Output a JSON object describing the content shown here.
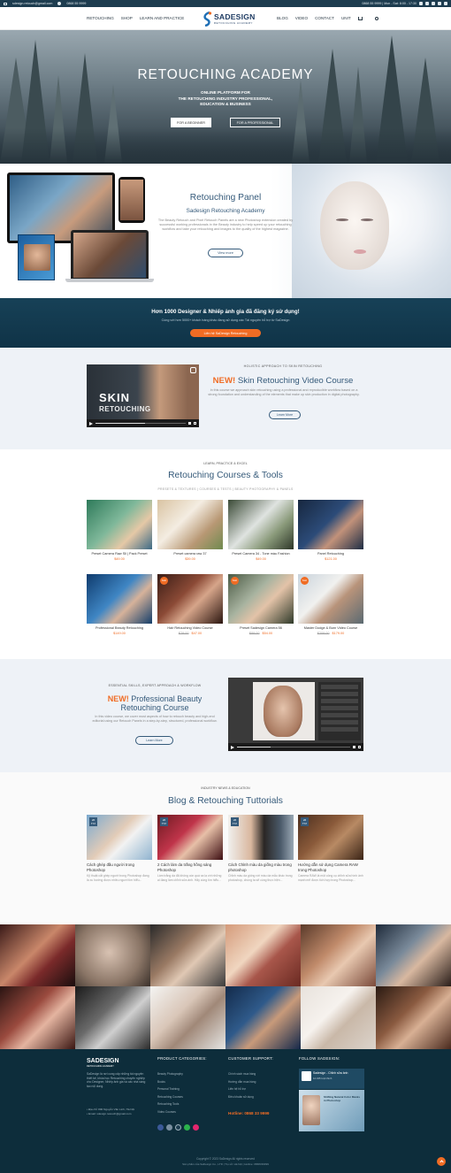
{
  "topbar": {
    "email": "sdesign.retouch@gmail.com",
    "phone": "0868 55 9999",
    "right_text": "0868 55 9999 | Mon - Sat: 8:00 - 17:30"
  },
  "nav": {
    "left": [
      "RETOUCHING",
      "SHOP",
      "LEARN AND PRACTICE"
    ],
    "logo_text": "SADESIGN",
    "logo_sub": "RETOUCHING ACADEMY",
    "right": [
      "BLOG",
      "VIDEO",
      "CONTACT",
      "UNIT"
    ]
  },
  "hero": {
    "title": "RETOUCHING ACADEMY",
    "subtitle_lines": [
      "ONLINE PLATFORM FOR",
      "THE RETOUCHING INDUSTRY PROFESSIONAL,",
      "EDUCATION & BUSINESS"
    ],
    "btn_beginner": "FOR A BEGINNER",
    "btn_pro": "FOR A PROFESSIONAL"
  },
  "panel": {
    "title": "Retouching Panel",
    "subtitle": "Sadesign Retouching Academy",
    "desc": "The Beauty Retouch and Pixel Retouch Panels are a new Photoshop extension created by successful working professionals in the Beauty industry to help speed up your retouching workflow and take your retouching and images to the quality of the highest magazine.",
    "btn": "View more"
  },
  "register": {
    "title": "Hơn 1000 Designer & Nhiếp ảnh gia đã đăng ký sử dụng!",
    "desc": "Cùng với hơn 5000+ khách hàng khác đang sử dụng các Tài nguyên hỗ trợ từ SaDesign",
    "btn": "Liên hệ SaDesign Retouching"
  },
  "skin": {
    "tag": "HOLISTIC APPROACH TO SKIN RETOUCHING",
    "title_new": "NEW!",
    "title": "Skin Retouching Video Course",
    "desc": "In this course we approach skin retouching using a professional and reproducible workflow based on a strong foundation and understanding of the elements that make up skin production in digital photography.",
    "btn": "Learn More",
    "video_word": "SKIN",
    "video_word2": "RETOUCHING"
  },
  "courses": {
    "tag": "LEARN, PRACTICE & EXCEL",
    "title": "Retouching Courses & Tools",
    "tabs": "PRESETS & TEXTURES | COURSES & TESTS | BEAUTY PHOTOGRAPHY & PANELS",
    "items": [
      {
        "title": "Preset Camera Raw Sll | Pack Preset",
        "old": "",
        "price": "$49.00",
        "sale": ""
      },
      {
        "title": "Preset camera raw 37",
        "old": "",
        "price": "$39.00",
        "sale": ""
      },
      {
        "title": "Preset Camera 34 - Tone màu Fashion",
        "old": "",
        "price": "$49.00",
        "sale": ""
      },
      {
        "title": "Panel Retouching",
        "old": "",
        "price": "$121.00",
        "sale": ""
      },
      {
        "title": "Professional Beauty Retouching",
        "old": "",
        "price": "$149.00",
        "sale": ""
      },
      {
        "title": "Hair Retouching Video Course",
        "old": "$79.00",
        "price": "$47.00",
        "sale": "Sale!"
      },
      {
        "title": "Preset Sadesign Camera 56",
        "old": "$89.00",
        "price": "$54.00",
        "sale": "Sale!"
      },
      {
        "title": "Master Dodge & Burn Video Course",
        "old": "$209.00",
        "price": "$179.00",
        "sale": "Sale!"
      }
    ]
  },
  "pro": {
    "tag": "ESSENTIAL SKILLS, EXPERT APPROACH & WORKFLOW",
    "title_new": "NEW!",
    "title": "Professional Beauty Retouching Course",
    "desc": "In this video course, we cover most aspects of how to retouch beauty and high-end editorial using our Retouch Panels in a step-by-step, structured, professional workflow.",
    "btn": "Learn More"
  },
  "blog": {
    "tag": "INDUSTRY NEWS & EDUCATION",
    "title": "Blog & Retouching Tuttorials",
    "posts": [
      {
        "day": "26",
        "month": "Th7",
        "title": "Cách ghép đầu người trong Photoshop",
        "desc": "Kỹ thuật cắt ghép người trong Photoshop đang là xu hướng được nhiều người tìm hiểu..."
      },
      {
        "day": "26",
        "month": "Th7",
        "title": "2 Cách làm da trắng hồng sáng Photoshop",
        "desc": "Làm trắng da đã không còn quá xa lạ với những ai đang làm chỉnh sửa ảnh. Hãy cùng tìm hiểu..."
      },
      {
        "day": "26",
        "month": "Th7",
        "title": "Cách Chỉnh màu da giống màu trong photoshop",
        "desc": "Chỉnh màu da giống với màu da mẫu khác trong photoshop, chúng ta sẽ cùng thực hiện..."
      },
      {
        "day": "26",
        "month": "Th7",
        "title": "Hướng dẫn sử dụng Camera RAW trong Photoshop",
        "desc": "Camera RAW là một công cụ chỉnh sửa hình ảnh mạnh mẽ được tích hợp trong Photoshop..."
      }
    ]
  },
  "footer": {
    "logo": "SADESIGN",
    "logo_sub": "RETOUCHING ACADEMY",
    "about": "SaDesign là nơi cung cấp những tài nguyên thiết kế, khóa học Retouching chuyên nghiệp cho Designer, Nhiếp ảnh gia và các nhà sáng tạo nội dung.",
    "address": "• Địa chỉ: 800 Nguyễn Văn Linh, Hà Nội\n• Email: sdesign.retouch@gmail.com",
    "cat_title": "PRODUCT CATEGORIES:",
    "cats": [
      "Beauty Photography",
      "Books",
      "Personal Training",
      "Retouching Courses",
      "Retouching Tools",
      "Video Courses"
    ],
    "support_title": "CUSTOMER SUPPORT:",
    "support": [
      "Chính sách mua hàng",
      "Hướng dẫn mua hàng",
      "Liên hệ hỗ trợ",
      "Điều khoản sử dụng"
    ],
    "hotline": "Hotline: 0868 33 9999",
    "follow_title": "FOLLOW SADESIGN:",
    "fb_name": "Sadesign - Chỉnh sửa ảnh",
    "fb_likes": "12.345 lượt thích",
    "fb_banner": "Shifting Natural Color Masks in Photoshop",
    "copy": "Copyright © 2023 SaDesign All rights reserved",
    "copy2": "Sản phẩm của SaDesign Co., LTD | Trụ sở: Hà Nội | Hotline: 0868339999"
  },
  "colors": {
    "primary": "#355a7a",
    "accent": "#f06c24",
    "footer_bg": "#0d2d3b"
  }
}
